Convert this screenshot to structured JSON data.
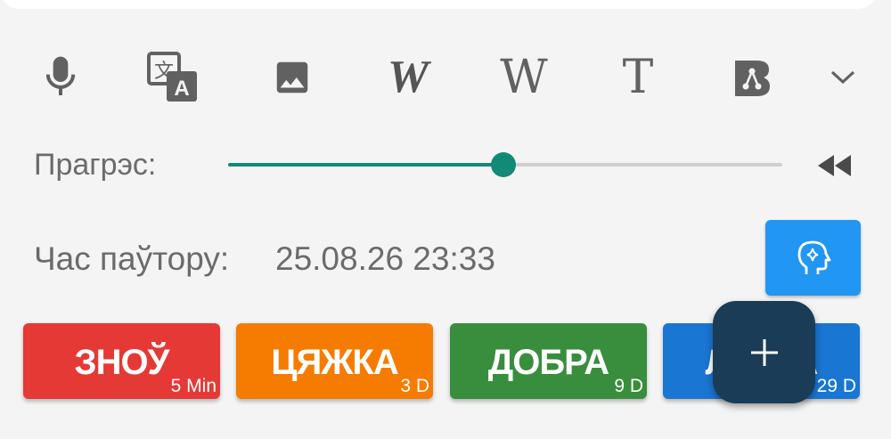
{
  "toolbar": {
    "tools": [
      {
        "icon": "microphone-icon"
      },
      {
        "icon": "translate-icon"
      },
      {
        "icon": "image-icon"
      },
      {
        "icon": "wordreference-icon",
        "glyph": "W"
      },
      {
        "icon": "wikipedia-icon",
        "glyph": "W"
      },
      {
        "icon": "text-icon",
        "glyph": "T"
      },
      {
        "icon": "bing-icon"
      },
      {
        "icon": "chevron-down-icon"
      }
    ]
  },
  "progress": {
    "label": "Прагрэс:",
    "value_fraction": 0.497,
    "accent": "#118a78"
  },
  "review": {
    "label": "Час паўтору:",
    "datetime": "25.08.26 23:33"
  },
  "answers": [
    {
      "label": "ЗНОЎ",
      "interval": "5 Min",
      "color": "#e53935"
    },
    {
      "label": "ЦЯЖКА",
      "interval": "3 D",
      "color": "#f57c00"
    },
    {
      "label": "ДОБРА",
      "interval": "9 D",
      "color": "#388e3c"
    },
    {
      "label": "ЛЁГКА",
      "interval": "29 D",
      "color": "#1976d2"
    }
  ],
  "fab": {
    "icon": "plus-icon",
    "glyph": "+",
    "color": "#1a3c56"
  },
  "ai_button": {
    "icon": "ai-head-icon",
    "color": "#2196f3"
  }
}
